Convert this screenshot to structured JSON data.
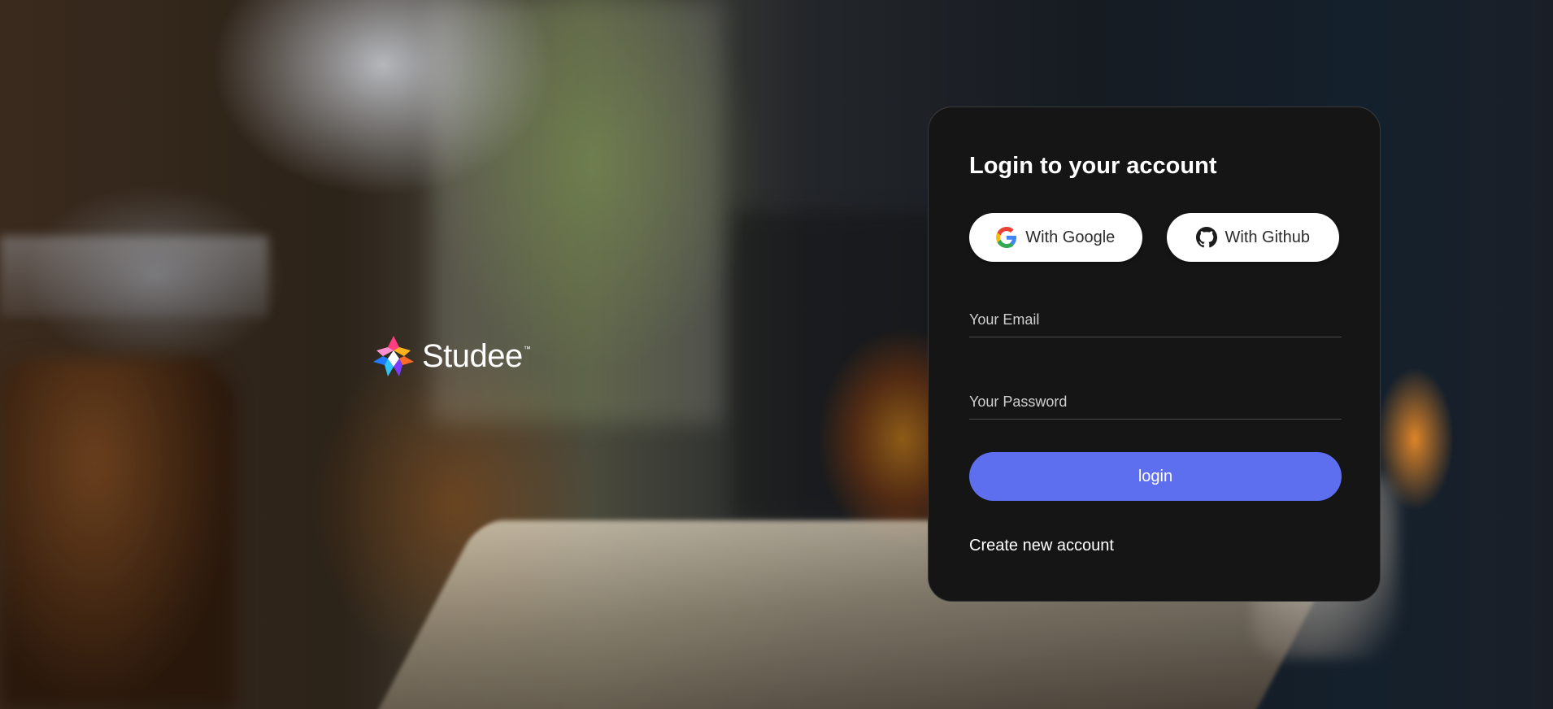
{
  "brand": {
    "name": "Studee",
    "trademark": "™"
  },
  "login_card": {
    "title": "Login to your account",
    "google_button_label": "With Google",
    "github_button_label": "With Github",
    "email_placeholder": "Your Email",
    "email_value": "",
    "password_placeholder": "Your Password",
    "password_value": "",
    "login_button_label": "login",
    "create_account_link": "Create new account"
  },
  "colors": {
    "card_background": "#151515",
    "primary_button": "#5d6fef",
    "oauth_button_background": "#ffffff"
  },
  "icons": {
    "google": "google-icon",
    "github": "github-icon",
    "brand_mark": "studee-logo-icon"
  }
}
